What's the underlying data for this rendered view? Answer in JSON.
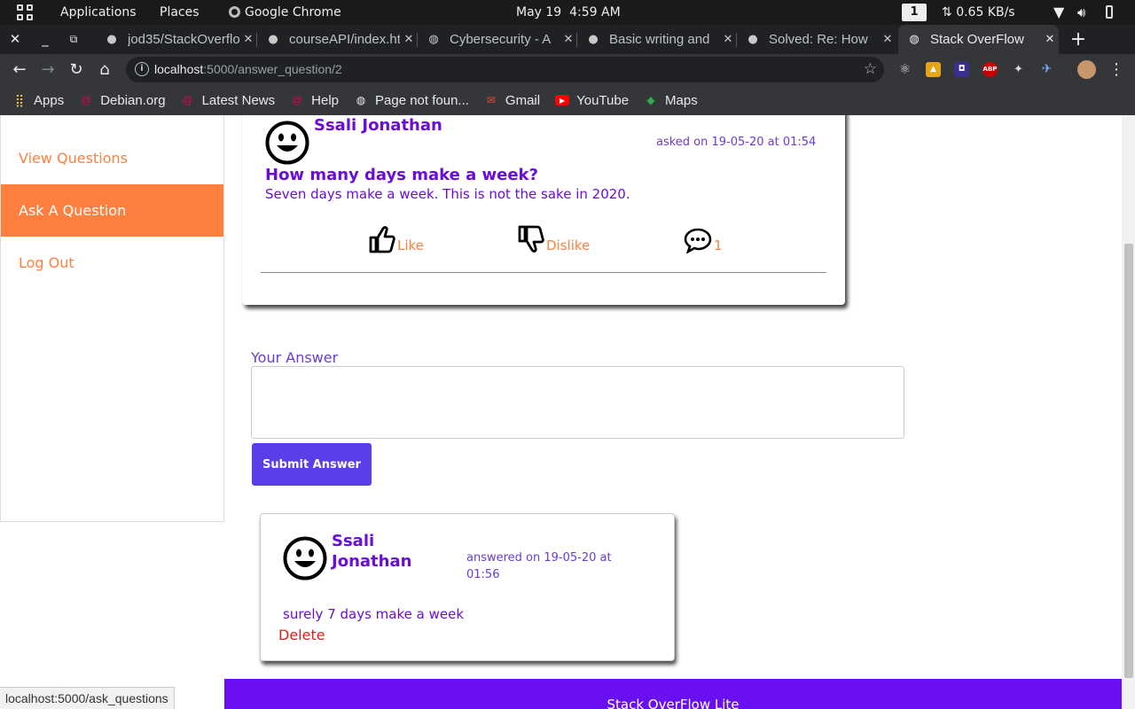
{
  "system_bar": {
    "applications": "Applications",
    "places": "Places",
    "active_app": "Google Chrome",
    "date": "May 19",
    "time": "4:59 AM",
    "workspace": "1",
    "net_speed": "0.65 KB/s"
  },
  "browser": {
    "tabs": [
      {
        "title": "jod35/StackOverflow",
        "icon": "github-icon"
      },
      {
        "title": "courseAPI/index.html",
        "icon": "github-icon"
      },
      {
        "title": "Cybersecurity - A",
        "icon": "globe-icon"
      },
      {
        "title": "Basic writing and",
        "icon": "github-icon"
      },
      {
        "title": "Solved: Re: How",
        "icon": "github-icon"
      },
      {
        "title": "Stack OverFlow",
        "icon": "globe-icon",
        "active": true
      }
    ],
    "url_host": "localhost",
    "url_path": ":5000/answer_question/2",
    "bookmarks": [
      {
        "label": "Apps",
        "icon": "apps-grid-icon"
      },
      {
        "label": "Debian.org",
        "icon": "debian-icon"
      },
      {
        "label": "Latest News",
        "icon": "debian-icon"
      },
      {
        "label": "Help",
        "icon": "debian-icon"
      },
      {
        "label": "Page not foun...",
        "icon": "globe-icon"
      },
      {
        "label": "Gmail",
        "icon": "gmail-icon"
      },
      {
        "label": "YouTube",
        "icon": "youtube-icon"
      },
      {
        "label": "Maps",
        "icon": "maps-icon"
      }
    ],
    "status_url": "localhost:5000/ask_questions"
  },
  "sidebar": {
    "items": [
      {
        "label": "View Questions"
      },
      {
        "label": "Ask A Question",
        "active": true
      },
      {
        "label": "Log Out"
      }
    ]
  },
  "question": {
    "author": "Ssali Jonathan",
    "asked_on": "asked on 19-05-20 at 01:54",
    "title": "How many days make a week?",
    "body": "Seven days make a week. This is not the sake in 2020.",
    "like_label": "Like",
    "dislike_label": "Dislike",
    "comment_count": "1"
  },
  "answer_form": {
    "label": "Your Answer",
    "value": "",
    "submit_label": "Submit Answer"
  },
  "answers": [
    {
      "author_first": "Ssali",
      "author_last": "Jonathan",
      "answered_on_line1": "answered on 19-05-20 at",
      "answered_on_line2": "01:56",
      "body": "surely 7 days make a week",
      "delete_label": "Delete"
    }
  ],
  "footer": {
    "text": "Stack OverFlow Lite"
  },
  "colors": {
    "accent_orange": "#ff7f3f",
    "accent_purple": "#6a0dd9",
    "button_purple": "#5a3fe8",
    "footer_purple": "#6a0ff0",
    "delete_red": "#e0201c"
  }
}
